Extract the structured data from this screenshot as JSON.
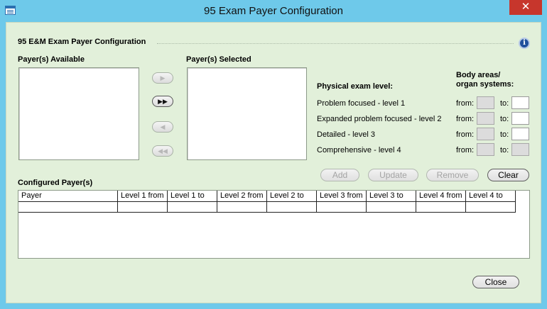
{
  "window": {
    "title": "95 Exam Payer Configuration",
    "close_glyph": "✕"
  },
  "section": {
    "title": "95 E&M Exam Payer Configuration",
    "info_glyph": "i"
  },
  "payers_available": {
    "label": "Payer(s) Available",
    "items": []
  },
  "payers_selected": {
    "label": "Payer(s) Selected",
    "items": []
  },
  "transfer_buttons": [
    {
      "name": "move-right-button",
      "glyph": "▶",
      "enabled": false
    },
    {
      "name": "move-all-right-button",
      "glyph": "▶▶",
      "enabled": true
    },
    {
      "name": "move-left-button",
      "glyph": "◀",
      "enabled": false
    },
    {
      "name": "move-all-left-button",
      "glyph": "◀◀",
      "enabled": false
    }
  ],
  "exam": {
    "level_header": "Physical exam level:",
    "body_areas_header_line1": "Body areas/",
    "body_areas_header_line2": "organ systems:",
    "from_label": "from:",
    "to_label": "to:",
    "levels": [
      {
        "label": "Problem focused - level 1",
        "from": "",
        "to": "",
        "from_enabled": false,
        "to_enabled": true
      },
      {
        "label": "Expanded problem focused - level 2",
        "from": "",
        "to": "",
        "from_enabled": false,
        "to_enabled": true
      },
      {
        "label": "Detailed - level 3",
        "from": "",
        "to": "",
        "from_enabled": false,
        "to_enabled": true
      },
      {
        "label": "Comprehensive - level 4",
        "from": "",
        "to": "",
        "from_enabled": false,
        "to_enabled": false
      }
    ]
  },
  "actions": {
    "add": "Add",
    "update": "Update",
    "remove": "Remove",
    "clear": "Clear"
  },
  "configured": {
    "label": "Configured Payer(s)",
    "columns": [
      "Payer",
      "Level 1 from",
      "Level 1 to",
      "Level 2 from",
      "Level 2 to",
      "Level 3 from",
      "Level 3 to",
      "Level 4 from",
      "Level 4 to"
    ],
    "rows": [
      [
        "",
        "",
        "",
        "",
        "",
        "",
        "",
        "",
        ""
      ]
    ]
  },
  "footer": {
    "close": "Close"
  }
}
